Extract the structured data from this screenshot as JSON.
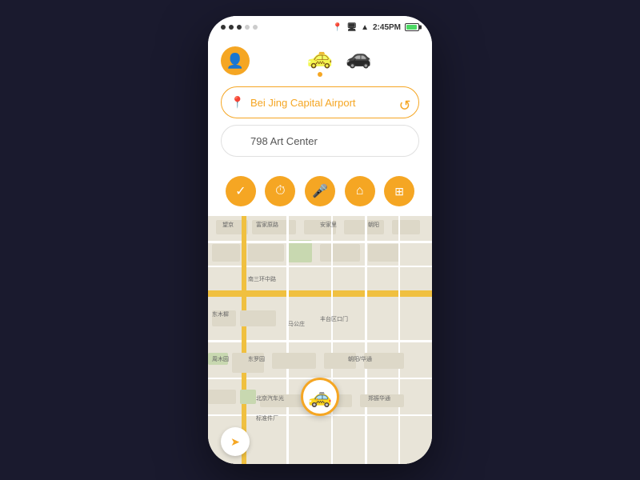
{
  "status": {
    "time": "2:45PM",
    "dots": [
      "active",
      "active",
      "active",
      "inactive",
      "inactive"
    ]
  },
  "header": {
    "avatar_icon": "👤"
  },
  "cars": [
    {
      "id": "taxi",
      "icon": "🚕",
      "active": true
    },
    {
      "id": "sedan",
      "icon": "🚗",
      "active": false
    }
  ],
  "inputs": {
    "from_placeholder": "Bei Jing Capital Airport",
    "to_placeholder": "798 Art Center"
  },
  "action_buttons": [
    {
      "id": "confirm",
      "icon": "✓",
      "label": "confirm"
    },
    {
      "id": "recent",
      "icon": "🕐",
      "label": "recent"
    },
    {
      "id": "voice",
      "icon": "🎤",
      "label": "voice"
    },
    {
      "id": "home",
      "icon": "⌂",
      "label": "home"
    },
    {
      "id": "building",
      "icon": "⊞",
      "label": "building"
    }
  ],
  "map": {
    "taxi_icon": "🚕",
    "compass_icon": "➤"
  }
}
